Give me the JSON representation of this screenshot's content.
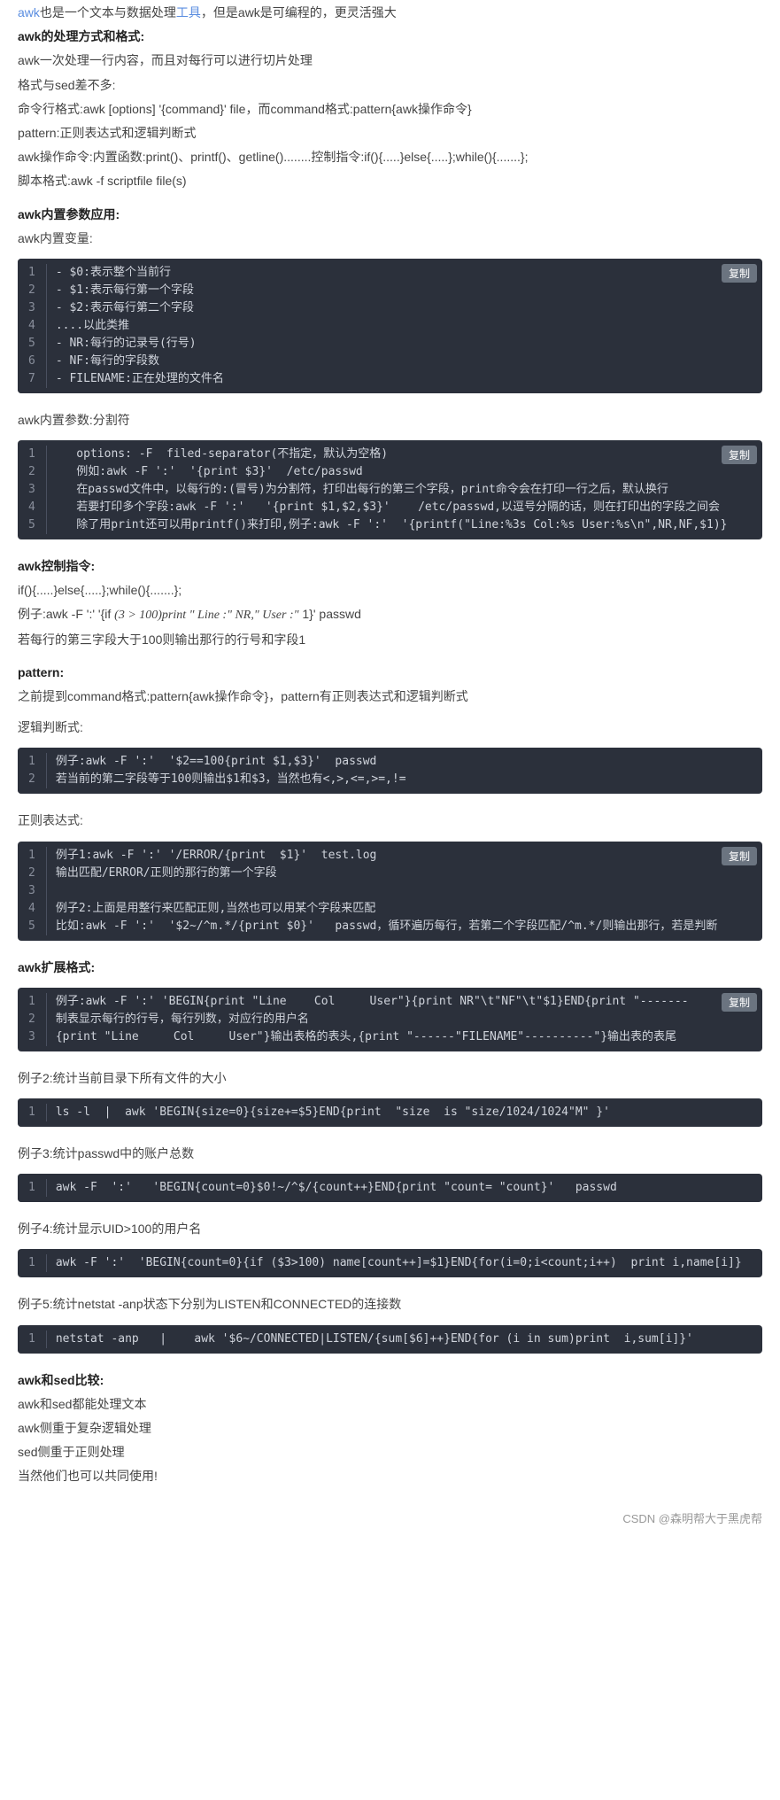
{
  "intro": "awk也是一个文本与数据处理工具，但是awk是可编程的，更灵活强大",
  "s1": {
    "title": "awk的处理方式和格式:",
    "lines": [
      "awk一次处理一行内容，而且对每行可以进行切片处理",
      "格式与sed差不多:",
      "命令行格式:awk [options] '{command}' file，而command格式:pattern{awk操作命令}",
      "pattern:正则表达式和逻辑判断式",
      "awk操作命令:内置函数:print()、printf()、getline()........控制指令:if(){.....}else{.....};while(){.......};",
      "脚本格式:awk -f scriptfile file(s)"
    ]
  },
  "s2": {
    "title": "awk内置参数应用:",
    "sub1": "awk内置变量:",
    "code1": [
      "- $0:表示整个当前行",
      "- $1:表示每行第一个字段",
      "- $2:表示每行第二个字段",
      "....以此类推",
      "- NR:每行的记录号(行号)",
      "- NF:每行的字段数",
      "- FILENAME:正在处理的文件名"
    ],
    "sub2": "awk内置参数:分割符",
    "code2": [
      "   options: -F  filed-separator(不指定，默认为空格)",
      "   例如:awk -F ':'  '{print $3}'  /etc/passwd",
      "   在passwd文件中，以每行的:(冒号)为分割符，打印出每行的第三个字段，print命令会在打印一行之后，默认换行",
      "   若要打印多个字段:awk -F ':'   '{print $1,$2,$3}'    /etc/passwd,以逗号分隔的话，则在打印出的字段之间会",
      "   除了用print还可以用printf()来打印,例子:awk -F ':'  '{printf(\"Line:%3s Col:%s User:%s\\n\",NR,NF,$1)}"
    ]
  },
  "s3": {
    "title": "awk控制指令:",
    "l1": "if(){.....}else{.....};while(){.......};",
    "l2_pre": "例子:awk -F ':' '{if ",
    "l2_math": "(3 > 100)print \" Line :\" NR,\" User :\"",
    "l2_post": " 1}' passwd",
    "l3": "若每行的第三字段大于100则输出那行的行号和字段1"
  },
  "s4": {
    "title": "pattern:",
    "l1": "之前提到command格式:pattern{awk操作命令}，pattern有正则表达式和逻辑判断式",
    "sub1": "逻辑判断式:",
    "code1": [
      "例子:awk -F ':'  '$2==100{print $1,$3}'  passwd",
      "若当前的第二字段等于100则输出$1和$3，当然也有<,>,<=,>=,!="
    ],
    "sub2": "正则表达式:",
    "code2": [
      "例子1:awk -F ':' '/ERROR/{print  $1}'  test.log",
      "输出匹配/ERROR/正则的那行的第一个字段",
      "",
      "例子2:上面是用整行来匹配正则,当然也可以用某个字段来匹配",
      "比如:awk -F ':'  '$2~/^m.*/{print $0}'   passwd，循环遍历每行，若第二个字段匹配/^m.*/则输出那行，若是判断"
    ]
  },
  "s5": {
    "title": "awk扩展格式:",
    "code1": [
      "例子:awk -F ':' 'BEGIN{print \"Line    Col     User\"}{print NR\"\\t\"NF\"\\t\"$1}END{print \"-------",
      "制表显示每行的行号，每行列数，对应行的用户名",
      "{print \"Line     Col     User\"}输出表格的表头,{print \"------\"FILENAME\"----------\"}输出表的表尾"
    ],
    "ex2": "例子2:统计当前目录下所有文件的大小",
    "code2": [
      "ls -l  |  awk 'BEGIN{size=0}{size+=$5}END{print  \"size  is \"size/1024/1024\"M\" }'"
    ],
    "ex3": "例子3:统计passwd中的账户总数",
    "code3": [
      "awk -F  ':'   'BEGIN{count=0}$0!~/^$/{count++}END{print \"count= \"count}'   passwd"
    ],
    "ex4": "例子4:统计显示UID>100的用户名",
    "code4": [
      "awk -F ':'  'BEGIN{count=0}{if ($3>100) name[count++]=$1}END{for(i=0;i<count;i++)  print i,name[i]}"
    ],
    "ex5": "例子5:统计netstat -anp状态下分别为LISTEN和CONNECTED的连接数",
    "code5": [
      "netstat -anp   |    awk '$6~/CONNECTED|LISTEN/{sum[$6]++}END{for (i in sum)print  i,sum[i]}'"
    ]
  },
  "s6": {
    "title": "awk和sed比较:",
    "lines": [
      "awk和sed都能处理文本",
      "awk侧重于复杂逻辑处理",
      "sed侧重于正则处理",
      "当然他们也可以共同使用!"
    ]
  },
  "copy": "复制",
  "footer_left": "CSDN",
  "footer_right": "@森明帮大于黑虎帮"
}
